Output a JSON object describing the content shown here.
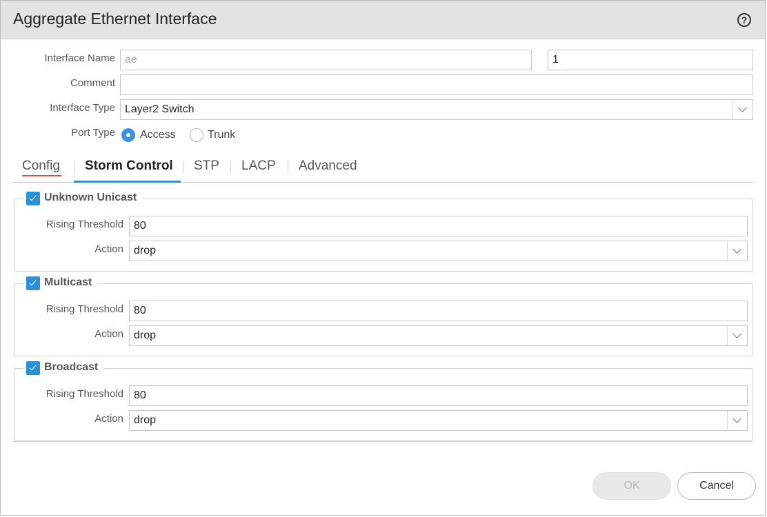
{
  "dialog": {
    "title": "Aggregate Ethernet Interface",
    "help_icon": "help-circle-icon"
  },
  "form": {
    "interface_name_label": "Interface Name",
    "interface_name_prefix": "ae",
    "interface_name_number": "1",
    "comment_label": "Comment",
    "comment_value": "",
    "interface_type_label": "Interface Type",
    "interface_type_value": "Layer2 Switch",
    "port_type_label": "Port Type",
    "port_type_options": [
      "Access",
      "Trunk"
    ],
    "port_type_selected": "Access"
  },
  "tabs": [
    {
      "label": "Config"
    },
    {
      "label": "Storm Control",
      "active": true
    },
    {
      "label": "STP"
    },
    {
      "label": "LACP"
    },
    {
      "label": "Advanced"
    }
  ],
  "storm_control": {
    "groups": [
      {
        "title": "Unknown Unicast",
        "checked": true,
        "rising_threshold_label": "Rising Threshold",
        "rising_threshold": "80",
        "action_label": "Action",
        "action": "drop"
      },
      {
        "title": "Multicast",
        "checked": true,
        "rising_threshold_label": "Rising Threshold",
        "rising_threshold": "80",
        "action_label": "Action",
        "action": "drop"
      },
      {
        "title": "Broadcast",
        "checked": true,
        "rising_threshold_label": "Rising Threshold",
        "rising_threshold": "80",
        "action_label": "Action",
        "action": "drop"
      }
    ]
  },
  "footer": {
    "ok_label": "OK",
    "ok_enabled": false,
    "cancel_label": "Cancel"
  },
  "colors": {
    "accent": "#2a8fd6",
    "radio_checked": "#3b93e0",
    "tab_config_underline": "#e0493b"
  }
}
